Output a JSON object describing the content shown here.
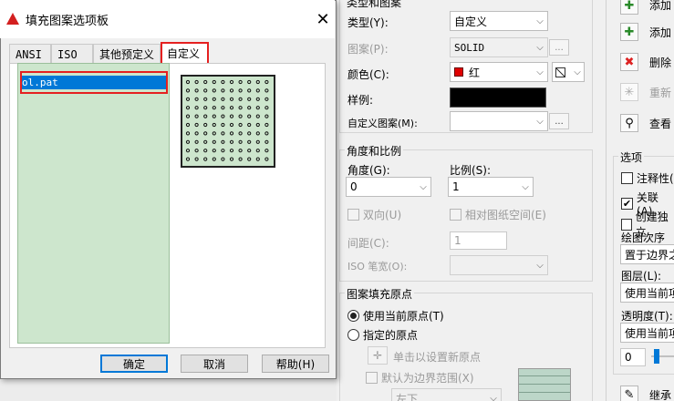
{
  "popup": {
    "title": "填充图案选项板",
    "tabs": [
      {
        "label": "ANSI"
      },
      {
        "label": "ISO"
      },
      {
        "label": "其他预定义"
      },
      {
        "label": "自定义"
      }
    ],
    "files": [
      "ol.pat"
    ],
    "buttons": {
      "ok": "确定",
      "cancel": "取消",
      "help": "帮助(H)"
    }
  },
  "main": {
    "type_group_title": "类型和图案",
    "type_label": "类型(Y):",
    "type_value": "自定义",
    "pattern_label": "图案(P):",
    "pattern_value": "SOLID",
    "color_label": "颜色(C):",
    "color_value": "红",
    "color_swatch": "#e00000",
    "sample_label": "样例:",
    "custom_pattern_label": "自定义图案(M):",
    "ellipsis": "...",
    "angle_group_title": "角度和比例",
    "angle_label": "角度(G):",
    "angle_value": "0",
    "scale_label": "比例(S):",
    "scale_value": "1",
    "double_label": "双向(U)",
    "relative_label": "相对图纸空间(E)",
    "spacing_label": "间距(C):",
    "spacing_value": "1",
    "iso_pen_label": "ISO 笔宽(O):",
    "origin_group_title": "图案填充原点",
    "use_current_origin": "使用当前原点(T)",
    "specified_origin": "指定的原点",
    "click_set_origin": "单击以设置新原点",
    "default_boundary": "默认为边界范围(X)",
    "origin_position": "左下"
  },
  "right": {
    "add1": "添加",
    "add2": "添加",
    "remove": "删除",
    "recreate": "重新",
    "view": "查看",
    "options_title": "选项",
    "annotative": "注释性(",
    "associative": "关联(A)",
    "create_separate": "创建独立",
    "draw_order_label": "绘图次序(W",
    "draw_order_value": "置于边界之",
    "layer_label": "图层(L):",
    "layer_value": "使用当前项",
    "transparency_label": "透明度(T):",
    "transparency_value": "使用当前项",
    "transparency_num": "0",
    "inherit": "继承"
  }
}
